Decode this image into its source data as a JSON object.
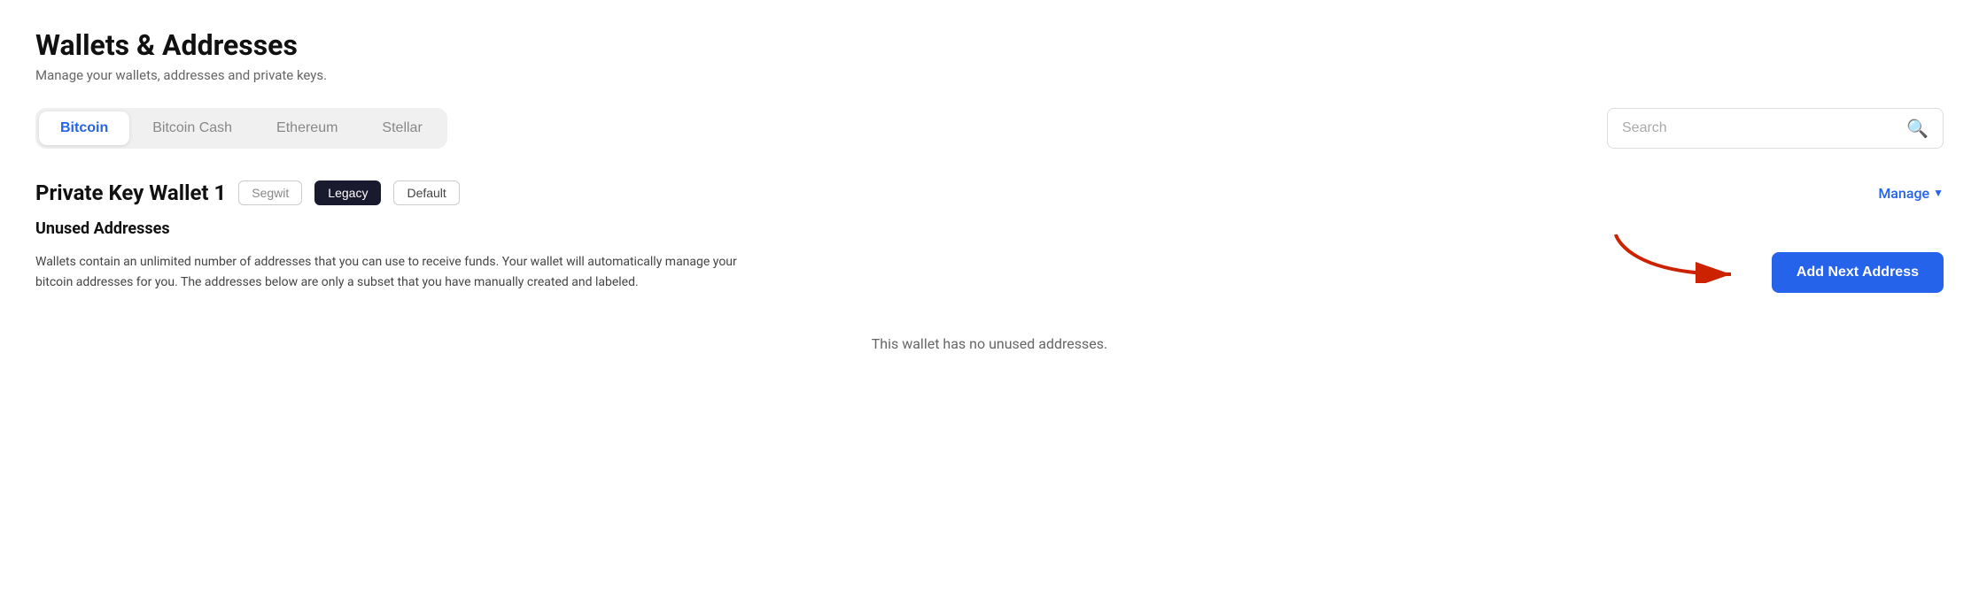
{
  "page": {
    "title": "Wallets & Addresses",
    "subtitle": "Manage your wallets, addresses and private keys."
  },
  "tabs": {
    "items": [
      {
        "label": "Bitcoin",
        "active": true
      },
      {
        "label": "Bitcoin Cash",
        "active": false
      },
      {
        "label": "Ethereum",
        "active": false
      },
      {
        "label": "Stellar",
        "active": false
      }
    ]
  },
  "search": {
    "placeholder": "Search"
  },
  "wallet": {
    "name": "Private Key Wallet 1",
    "badges": {
      "segwit": "Segwit",
      "legacy": "Legacy",
      "default": "Default"
    },
    "manage_label": "Manage"
  },
  "unused_addresses": {
    "section_title": "Unused Addresses",
    "description": "Wallets contain an unlimited number of addresses that you can use to receive funds. Your wallet will automatically manage your bitcoin addresses for you. The addresses below are only a subset that you have manually created and labeled.",
    "empty_state": "This wallet has no unused addresses.",
    "add_button": "Add Next Address"
  }
}
